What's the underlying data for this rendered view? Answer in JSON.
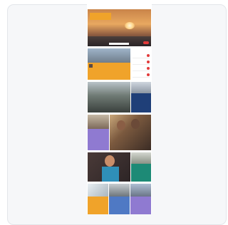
{
  "status_bar": {
    "carrier": "",
    "title": "",
    "battery": ""
  },
  "hero": {
    "tag": "",
    "button": ""
  },
  "tiles": {
    "orange_caption": "",
    "dark_caption": "",
    "navy_caption": "",
    "purple_caption": "",
    "teal_caption": "",
    "orange2_caption": "",
    "blue2_caption": "",
    "purple2_caption": ""
  },
  "links": [
    "",
    "",
    "",
    ""
  ],
  "colors": {
    "orange": "#f0a32a",
    "navy": "#1f3f78",
    "purple": "#8f7ad1",
    "teal": "#1d8a76",
    "blue": "#4f79c4",
    "red": "#e23b3b"
  }
}
